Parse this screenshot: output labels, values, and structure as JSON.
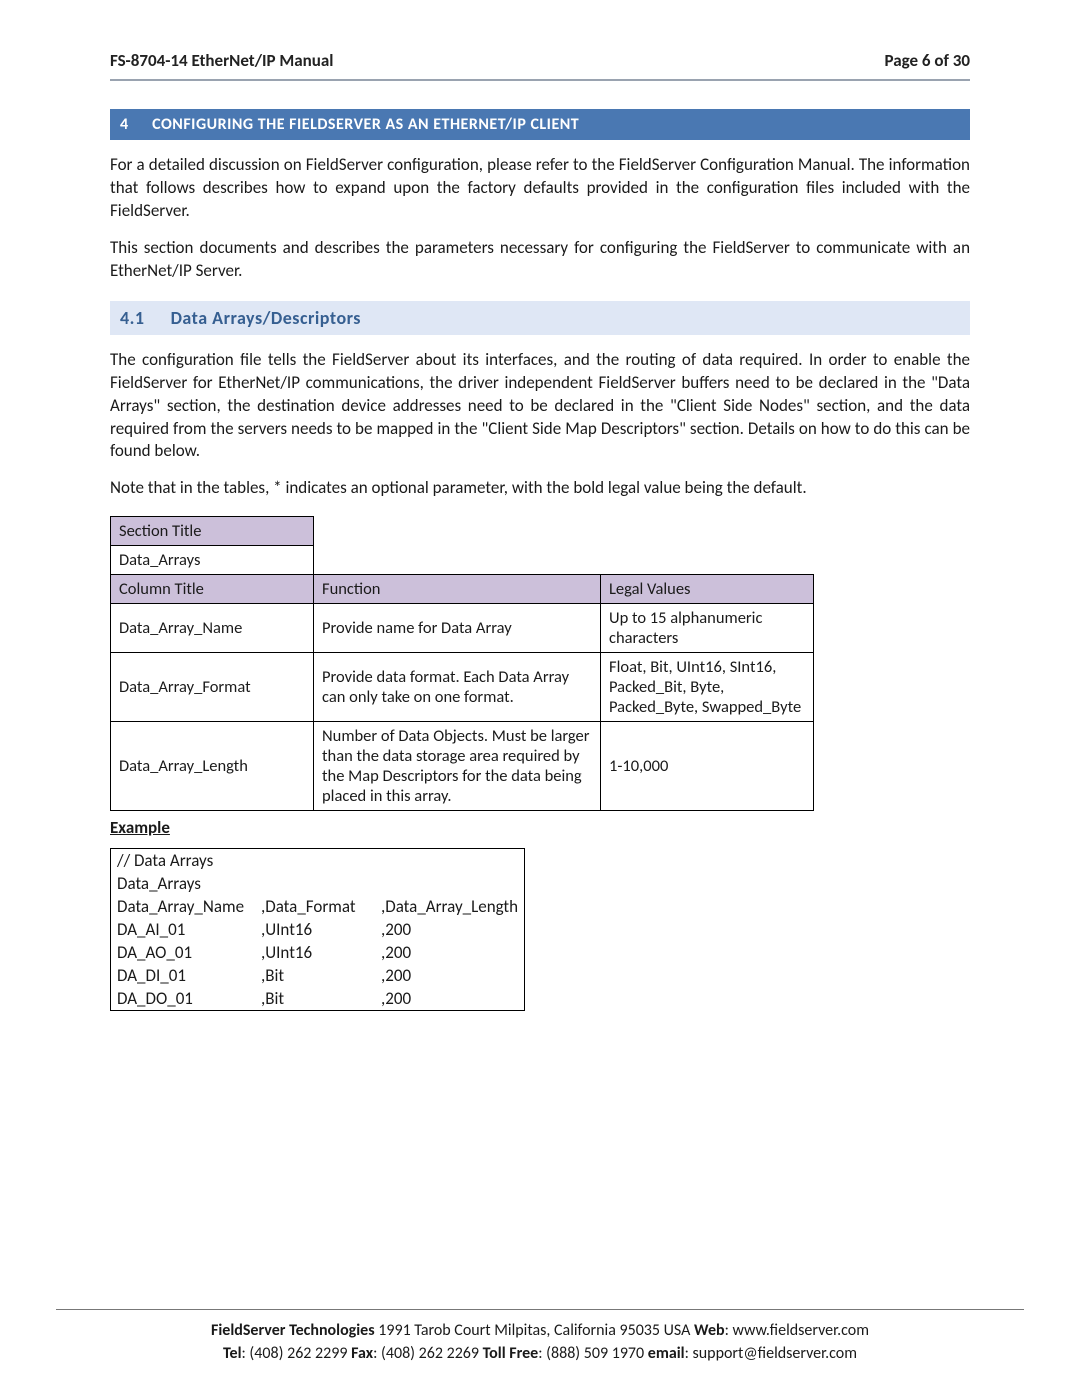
{
  "header": {
    "doc_title": "FS-8704-14 EtherNet/IP Manual",
    "page_label": "Page 6 of 30"
  },
  "section": {
    "number": "4",
    "title": "CONFIGURING THE FIELDSERVER AS AN ETHERNET/IP CLIENT"
  },
  "para1": "For a detailed discussion on FieldServer configuration, please refer to the FieldServer Configuration Manual.  The information that follows describes how to expand upon the factory defaults provided in the configuration files included with the FieldServer.",
  "para2": "This section documents and describes the parameters necessary for configuring the FieldServer to communicate with an EtherNet/IP Server.",
  "subsection": {
    "number": "4.1",
    "title": "Data Arrays/Descriptors"
  },
  "para3": "The configuration file tells the FieldServer about its interfaces, and the routing of data required. In order to enable the FieldServer for EtherNet/IP communications, the driver independent FieldServer buffers need to be declared in the \"Data Arrays\" section, the destination device addresses need to be declared in the \"Client Side Nodes\" section, and the data required from the servers needs to be mapped in the \"Client Side Map Descriptors\" section.  Details on how to do this can be found below.",
  "para4": "Note that in the tables, * indicates an optional parameter, with the bold legal value being the default.",
  "param_table": {
    "section_title_label": "Section Title",
    "section_title_value": "Data_Arrays",
    "headers": {
      "col": "Column Title",
      "func": "Function",
      "legal": "Legal Values"
    },
    "rows": [
      {
        "col": "Data_Array_Name",
        "func": "Provide name for Data Array",
        "legal": "Up to 15 alphanumeric characters"
      },
      {
        "col": "Data_Array_Format",
        "func": "Provide data format. Each Data Array can only take on one format.",
        "legal": "Float, Bit, UInt16, SInt16, Packed_Bit, Byte, Packed_Byte, Swapped_Byte"
      },
      {
        "col": "Data_Array_Length",
        "func": "Number of Data Objects. Must be larger than the data storage area required by the Map Descriptors for the data being placed in this array.",
        "legal": "1-10,000"
      }
    ]
  },
  "example_label": "Example",
  "example": {
    "comment": "//    Data Arrays",
    "section": "Data_Arrays",
    "headers": [
      "Data_Array_Name",
      ",Data_Format",
      ",Data_Array_Length"
    ],
    "rows": [
      [
        "DA_AI_01",
        ",UInt16",
        ",200"
      ],
      [
        "DA_AO_01",
        ",UInt16",
        ",200"
      ],
      [
        "DA_DI_01",
        ",Bit",
        ",200"
      ],
      [
        "DA_DO_01",
        ",Bit",
        ",200"
      ]
    ]
  },
  "footer": {
    "line1_company": "FieldServer Technologies",
    "line1_addr": " 1991 Tarob Court Milpitas, California 95035 USA   ",
    "line1_web_label": "Web",
    "line1_web": ": www.fieldserver.com",
    "line2_tel_label": "Tel",
    "line2_tel": ": (408) 262 2299   ",
    "line2_fax_label": "Fax",
    "line2_fax": ": (408) 262 2269   ",
    "line2_toll_label": "Toll Free",
    "line2_toll": ": (888) 509 1970   ",
    "line2_email_label": "email",
    "line2_email": ": support@fieldserver.com"
  }
}
